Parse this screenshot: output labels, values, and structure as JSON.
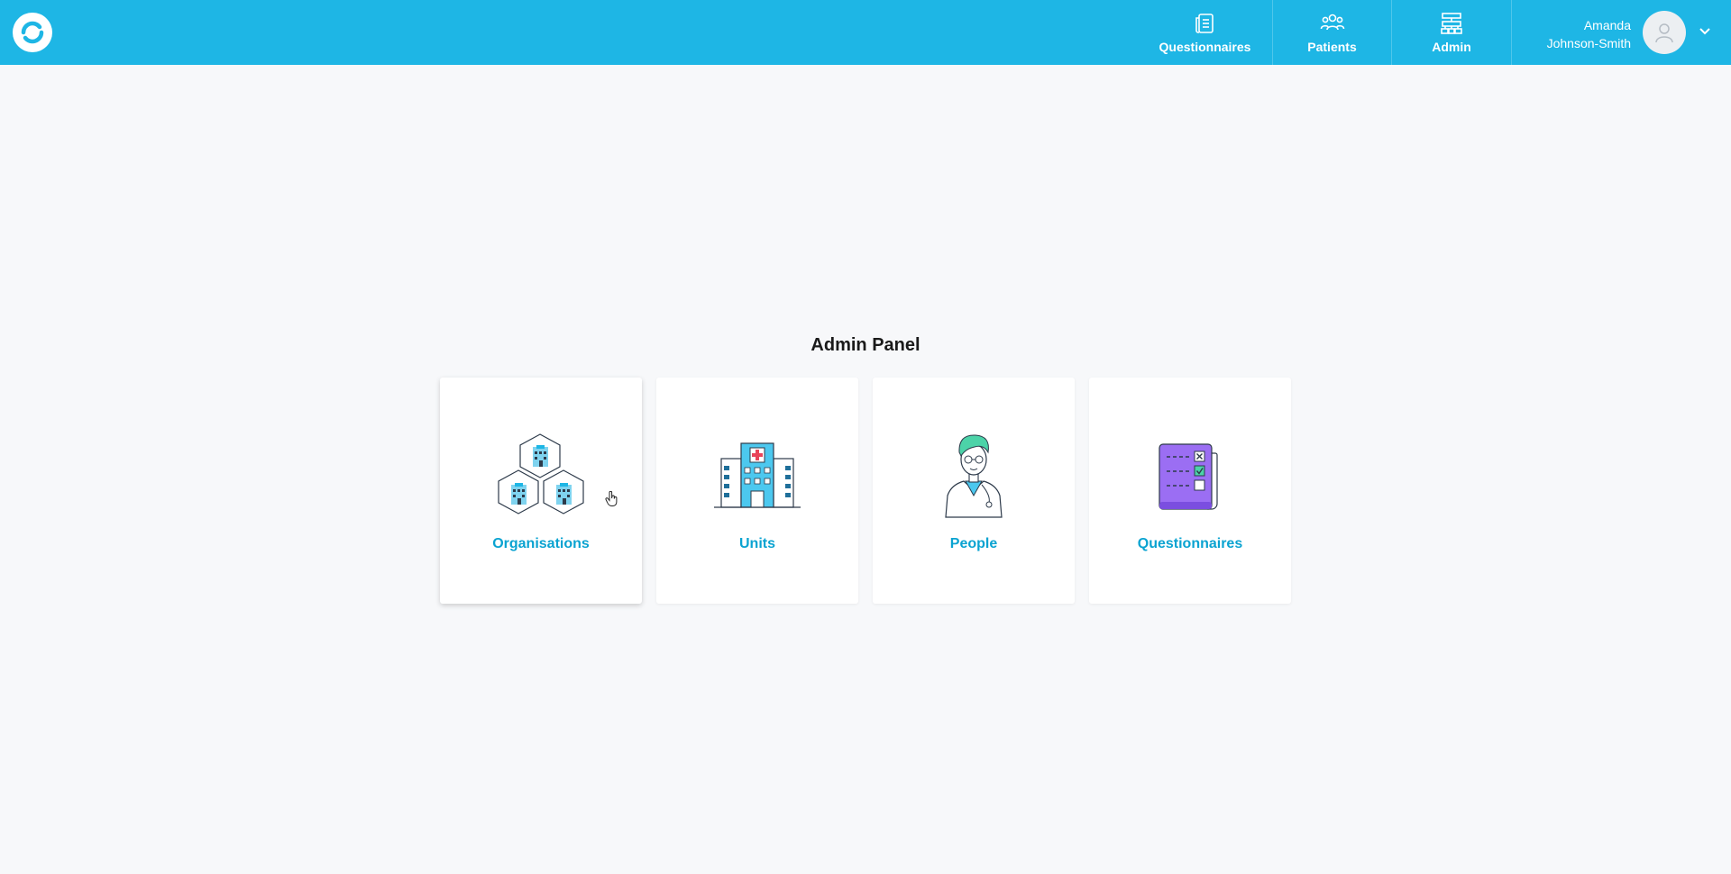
{
  "header": {
    "logo_icon": "refresh-circle-icon",
    "nav": [
      {
        "label": "Questionnaires",
        "icon": "document-list-icon"
      },
      {
        "label": "Patients",
        "icon": "users-group-icon"
      },
      {
        "label": "Admin",
        "icon": "sitemap-icon"
      }
    ],
    "user": {
      "first_name": "Amanda",
      "last_name": "Johnson-Smith",
      "avatar_icon": "user-avatar-icon"
    }
  },
  "main": {
    "title": "Admin Panel",
    "cards": [
      {
        "label": "Organisations",
        "icon": "hexagon-buildings-icon"
      },
      {
        "label": "Units",
        "icon": "hospital-building-icon"
      },
      {
        "label": "People",
        "icon": "doctor-person-icon"
      },
      {
        "label": "Questionnaires",
        "icon": "questionnaire-checklist-icon"
      }
    ]
  },
  "colors": {
    "header": "#1eb6e5",
    "accent": "#0aa3d1",
    "background": "#f7f8fa",
    "purple": "#9b6ef3",
    "teal": "#4cd3a8"
  }
}
